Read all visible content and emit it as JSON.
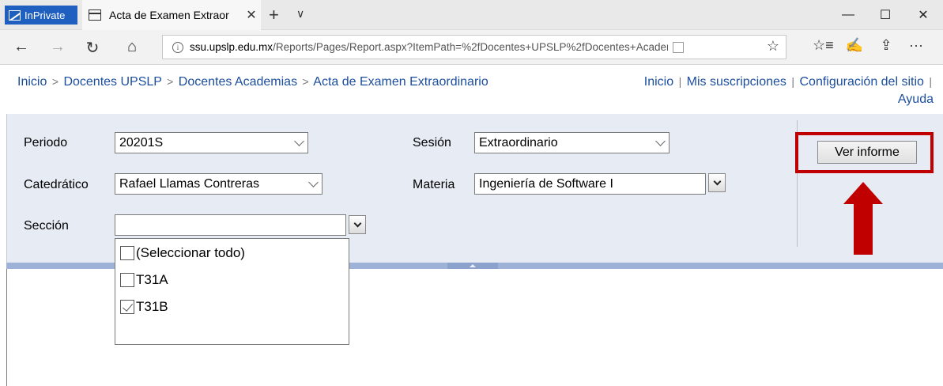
{
  "browser": {
    "inprivate_label": "InPrivate",
    "tab_title": "Acta de Examen Extraor",
    "tab_close": "✕",
    "new_tab": "+",
    "tab_list": "∨",
    "minimize": "—",
    "maximize": "☐",
    "close": "✕",
    "back": "←",
    "forward": "→",
    "refresh": "↻",
    "home": "⌂",
    "url_host": "ssu.upslp.edu.mx",
    "url_path": "/Reports/Pages/Report.aspx?ItemPath=%2fDocentes+UPSLP%2fDocentes+Academias%",
    "favorite": "☆",
    "favorites_list": "☆≡",
    "notes": "✍",
    "share": "⇪",
    "more": "···"
  },
  "breadcrumb": {
    "items": [
      "Inicio",
      "Docentes UPSLP",
      "Docentes Academias",
      "Acta de Examen Extraordinario"
    ],
    "separator": ">"
  },
  "top_links": {
    "home": "Inicio",
    "subscriptions": "Mis suscripciones",
    "site_settings": "Configuración del sitio",
    "help": "Ayuda",
    "separator": "|"
  },
  "parameters": {
    "periodo": {
      "label": "Periodo",
      "value": "20201S"
    },
    "sesion": {
      "label": "Sesión",
      "value": "Extraordinario"
    },
    "catedratico": {
      "label": "Catedrático",
      "value": "Rafael Llamas Contreras"
    },
    "materia": {
      "label": "Materia",
      "value": "Ingeniería de Software I"
    },
    "seccion": {
      "label": "Sección",
      "value": ""
    }
  },
  "seccion_options": [
    {
      "label": "(Seleccionar todo)",
      "checked": false
    },
    {
      "label": "T31A",
      "checked": false
    },
    {
      "label": "T31B",
      "checked": true
    }
  ],
  "view_report_button": "Ver informe",
  "colors": {
    "link": "#1c4e9e",
    "param_bg": "#e6ebf4",
    "highlight": "#c00000",
    "inprivate": "#1f5fbf"
  }
}
